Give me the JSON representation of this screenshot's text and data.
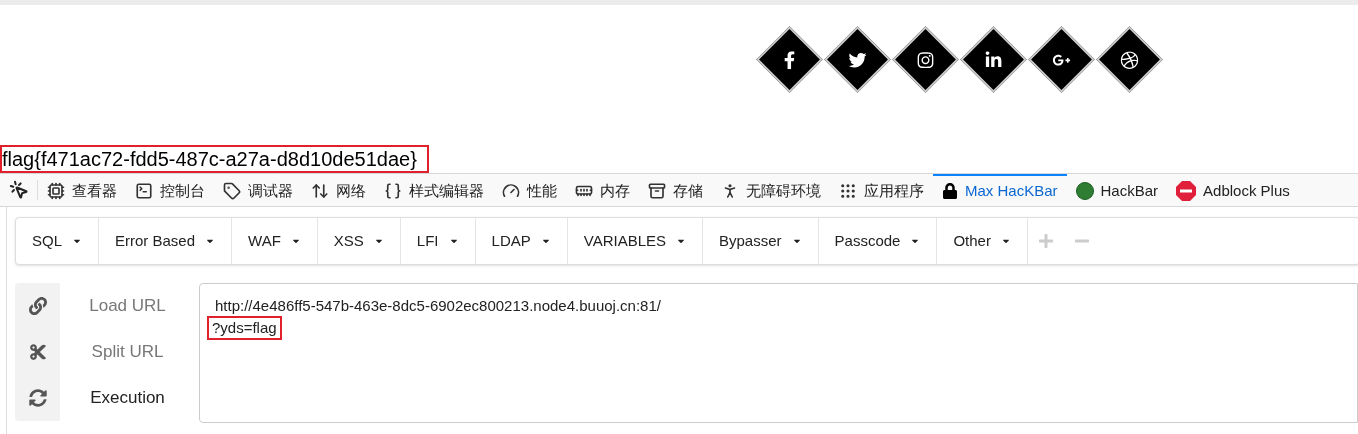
{
  "social_links": [
    {
      "kind": "facebook"
    },
    {
      "kind": "twitter"
    },
    {
      "kind": "instagram"
    },
    {
      "kind": "linkedin"
    },
    {
      "kind": "googleplus"
    },
    {
      "kind": "dribbble"
    }
  ],
  "flag_text": "flag{f471ac72-fdd5-487c-a27a-d8d10de51dae}",
  "devtools_tabs": [
    {
      "label": "查看器",
      "kind": "inspector",
      "selected": false
    },
    {
      "label": "控制台",
      "kind": "console",
      "selected": false
    },
    {
      "label": "调试器",
      "kind": "debugger",
      "selected": false
    },
    {
      "label": "网络",
      "kind": "network",
      "selected": false
    },
    {
      "label": "样式编辑器",
      "kind": "style",
      "selected": false
    },
    {
      "label": "性能",
      "kind": "performance",
      "selected": false
    },
    {
      "label": "内存",
      "kind": "memory",
      "selected": false
    },
    {
      "label": "存储",
      "kind": "storage",
      "selected": false
    },
    {
      "label": "无障碍环境",
      "kind": "accessibility",
      "selected": false
    },
    {
      "label": "应用程序",
      "kind": "apps",
      "selected": false
    },
    {
      "label": "Max HacKBar",
      "kind": "lock",
      "selected": true
    },
    {
      "label": "HackBar",
      "kind": "hackbar",
      "selected": false
    },
    {
      "label": "Adblock Plus",
      "kind": "abp",
      "selected": false
    }
  ],
  "menu": [
    "SQL",
    "Error Based",
    "WAF",
    "XSS",
    "LFI",
    "LDAP",
    "VARIABLES",
    "Bypasser",
    "Passcode",
    "Other"
  ],
  "actions": [
    {
      "label": "Load URL",
      "kind": "link",
      "disabled": true
    },
    {
      "label": "Split URL",
      "kind": "scissors",
      "disabled": true
    },
    {
      "label": "Execution",
      "kind": "refresh",
      "disabled": false
    }
  ],
  "url_lines": [
    {
      "text": "http://4e486ff5-547b-463e-8dc5-6902ec800213.node4.buuoj.cn:81/",
      "highlighted": false
    },
    {
      "text": "?yds=flag",
      "highlighted": true
    }
  ]
}
